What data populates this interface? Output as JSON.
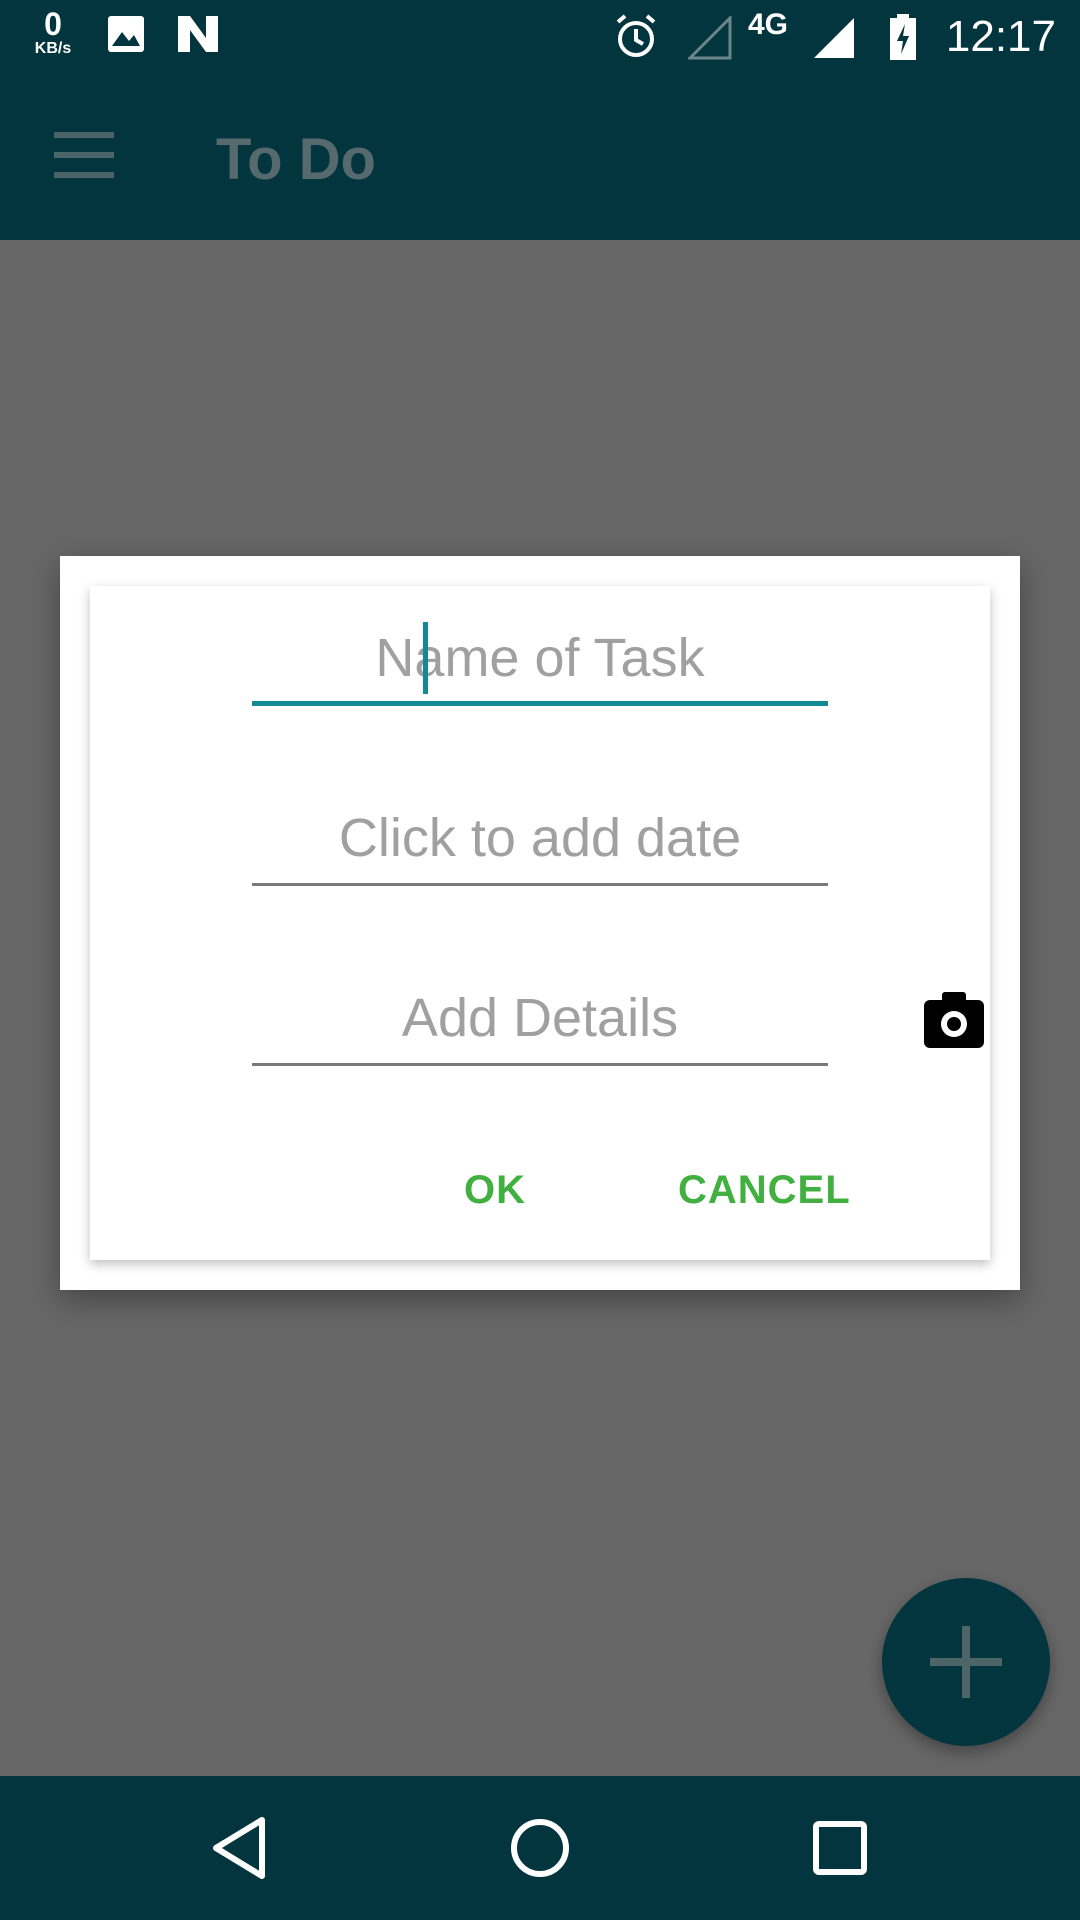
{
  "status_bar": {
    "net_speed_value": "0",
    "net_speed_unit": "KB/s",
    "network_type": "4G",
    "time": "12:17",
    "icons": [
      "image-icon",
      "n-logo-icon",
      "alarm-icon",
      "signal-empty-icon",
      "signal-full-icon",
      "battery-charging-icon"
    ]
  },
  "app_bar": {
    "title": "To Do",
    "menu_icon": "hamburger-menu-icon"
  },
  "dialog": {
    "task_name": {
      "placeholder": "Name of Task",
      "value": ""
    },
    "date": {
      "placeholder": "Click to add date",
      "value": ""
    },
    "details": {
      "placeholder": "Add Details",
      "value": ""
    },
    "camera_icon": "camera-icon",
    "ok_label": "OK",
    "cancel_label": "CANCEL"
  },
  "fab": {
    "icon": "plus-icon"
  },
  "nav_bar": {
    "icons": [
      "back-icon",
      "home-icon",
      "recents-icon"
    ]
  },
  "colors": {
    "primary_dark": "#02353d",
    "accent": "#118a93",
    "button_text": "#41b040",
    "scrim": "#676767"
  }
}
